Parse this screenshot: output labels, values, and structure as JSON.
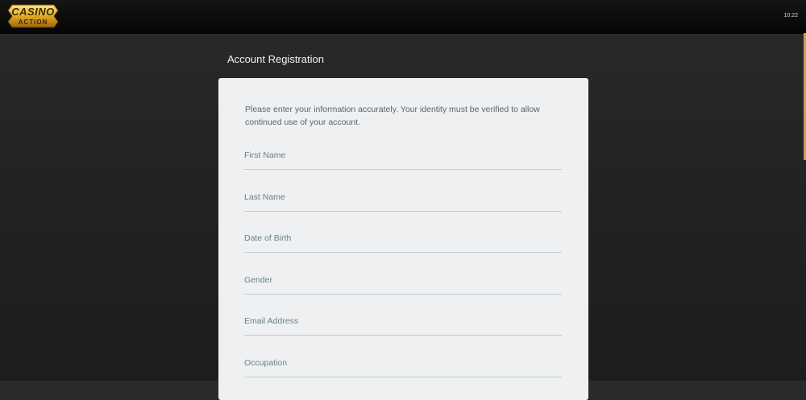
{
  "header": {
    "logo_text_main": "CASINO",
    "logo_text_sub": "ACTION",
    "clock": "10:22"
  },
  "colors": {
    "accent_gold": "#e8b830",
    "page_background": "#232323",
    "card_background": "#eef0f1",
    "field_label": "#69808a"
  },
  "page": {
    "title": "Account Registration"
  },
  "form": {
    "intro": "Please enter your information accurately. Your identity must be verified to allow continued use of your account.",
    "fields": [
      {
        "label": "First Name"
      },
      {
        "label": "Last Name"
      },
      {
        "label": "Date of Birth"
      },
      {
        "label": "Gender"
      },
      {
        "label": "Email Address"
      },
      {
        "label": "Occupation"
      }
    ]
  }
}
